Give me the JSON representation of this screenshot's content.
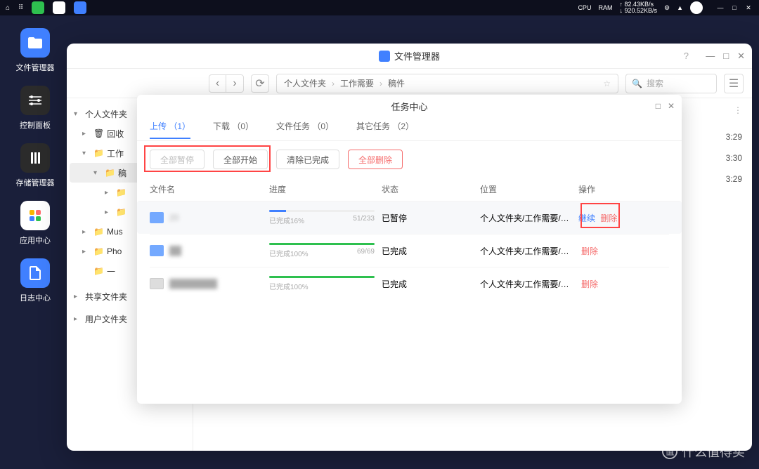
{
  "topbar": {
    "cpu": "CPU",
    "ram": "RAM",
    "up": "↑ 82.43KB/s",
    "down": "↓ 920.52KB/s"
  },
  "dock": [
    {
      "label": "文件管理器",
      "color": "#4080ff"
    },
    {
      "label": "控制面板",
      "color": "#2b2b2b"
    },
    {
      "label": "存储管理器",
      "color": "#2b2b2b"
    },
    {
      "label": "应用中心",
      "color": "#ffffff"
    },
    {
      "label": "日志中心",
      "color": "#4080ff"
    }
  ],
  "main_window": {
    "title": "文件管理器",
    "breadcrumb": [
      "个人文件夹",
      "工作需要",
      "稿件"
    ],
    "search_placeholder": "搜索",
    "sidebar": {
      "root": "个人文件夹",
      "items": [
        {
          "label": "回收",
          "icon": "trash",
          "level": 1
        },
        {
          "label": "工作",
          "icon": "folder",
          "level": 1,
          "expanded": true
        },
        {
          "label": "稿",
          "icon": "folder",
          "level": 2,
          "active": true
        },
        {
          "label": "",
          "icon": "folder",
          "level": 3
        },
        {
          "label": "",
          "icon": "folder",
          "level": 3
        },
        {
          "label": "Mus",
          "icon": "folder",
          "level": 1
        },
        {
          "label": "Pho",
          "icon": "folder",
          "level": 1
        },
        {
          "label": "一 ",
          "icon": "folder",
          "level": 1
        }
      ],
      "shared": "共享文件夹",
      "user": "用户文件夹"
    },
    "times": [
      "3:29",
      "3:30",
      "3:29"
    ]
  },
  "task_window": {
    "title": "任务中心",
    "tabs": [
      {
        "label": "上传 （1）",
        "active": true
      },
      {
        "label": "下载 （0）"
      },
      {
        "label": "文件任务 （0）"
      },
      {
        "label": "其它任务 （2）"
      }
    ],
    "actions": {
      "pause_all": "全部暂停",
      "start_all": "全部开始",
      "clear_done": "清除已完成",
      "delete_all": "全部删除"
    },
    "columns": {
      "name": "文件名",
      "progress": "进度",
      "status": "状态",
      "location": "位置",
      "action": "操作"
    },
    "rows": [
      {
        "name": "20",
        "icon": "folder",
        "progress_pct": 16,
        "progress_text": "已完成16%",
        "count": "51/233",
        "status": "已暂停",
        "location": "个人文件夹/工作需要/…",
        "actions": [
          "继续",
          "删除"
        ],
        "color": "blue",
        "highlighted": true
      },
      {
        "name": " ",
        "icon": "folder",
        "progress_pct": 100,
        "progress_text": "已完成100%",
        "count": "69/69",
        "status": "已完成",
        "location": "个人文件夹/工作需要/…",
        "actions": [
          "删除"
        ],
        "color": "green"
      },
      {
        "name": " ",
        "icon": "doc",
        "progress_pct": 100,
        "progress_text": "已完成100%",
        "count": "",
        "status": "已完成",
        "location": "个人文件夹/工作需要/…",
        "actions": [
          "删除"
        ],
        "color": "green"
      }
    ]
  },
  "watermark": "什么值得买"
}
